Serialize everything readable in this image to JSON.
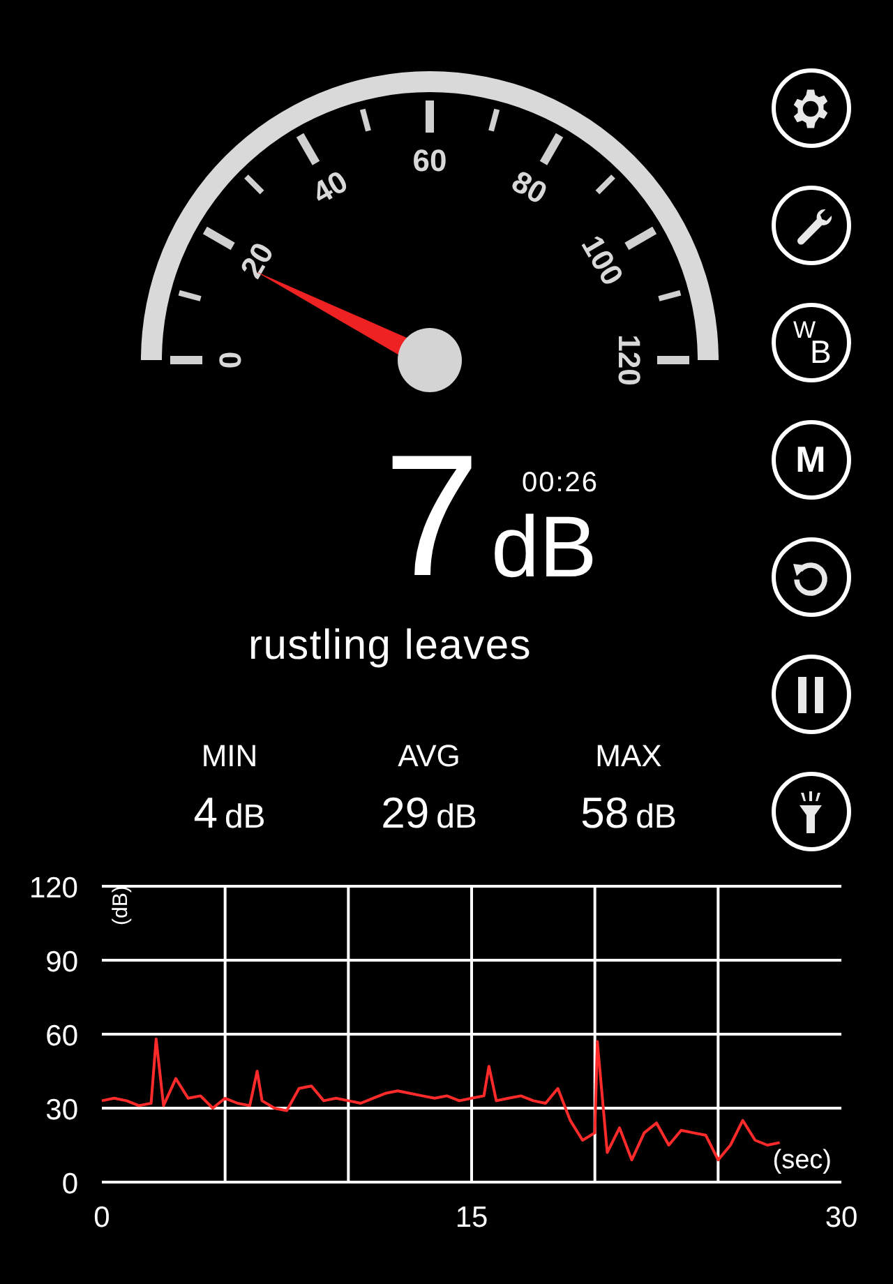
{
  "gauge": {
    "labels": [
      "0",
      "20",
      "40",
      "60",
      "80",
      "100",
      "120"
    ]
  },
  "reading": {
    "value": "7",
    "unit": "dB",
    "timer": "00:26",
    "description": "rustling leaves"
  },
  "stats": [
    {
      "label": "MIN",
      "value": "4",
      "unit": "dB"
    },
    {
      "label": "AVG",
      "value": "29",
      "unit": "dB"
    },
    {
      "label": "MAX",
      "value": "58",
      "unit": "dB"
    }
  ],
  "buttons": [
    {
      "kind": "settings"
    },
    {
      "kind": "wrench"
    },
    {
      "kind": "pair",
      "top": "W",
      "bottom": "B"
    },
    {
      "kind": "letter",
      "label": "M"
    },
    {
      "kind": "reset"
    },
    {
      "kind": "pause"
    },
    {
      "kind": "flashlight"
    }
  ],
  "chart": {
    "chart_data": {
      "type": "line",
      "xlabel": "(sec)",
      "ylabel": "(dB)",
      "xlim": [
        0,
        30
      ],
      "ylim": [
        0,
        120
      ],
      "xticks": [
        0,
        15,
        30
      ],
      "grid": true,
      "yticks": [
        0,
        30,
        60,
        90,
        120
      ],
      "x": [
        0,
        0.5,
        1,
        1.5,
        2,
        2.2,
        2.5,
        3,
        3.5,
        4,
        4.5,
        5,
        5.5,
        6,
        6.3,
        6.5,
        7,
        7.5,
        8,
        8.5,
        9,
        9.5,
        10,
        10.5,
        11,
        11.5,
        12,
        12.5,
        13,
        13.5,
        14,
        14.5,
        15,
        15.5,
        15.7,
        16,
        16.5,
        17,
        17.5,
        18,
        18.5,
        19,
        19.5,
        20,
        20.1,
        20.5,
        21,
        21.5,
        22,
        22.5,
        23,
        23.5,
        24,
        24.5,
        25,
        25.5,
        26,
        26.5,
        27,
        27.5
      ],
      "series": [
        {
          "color": "#ff2a2a",
          "values": [
            33,
            34,
            33,
            31,
            32,
            58,
            31,
            42,
            34,
            35,
            30,
            34,
            32,
            31,
            45,
            33,
            30,
            29,
            38,
            39,
            33,
            34,
            33,
            32,
            34,
            36,
            37,
            36,
            35,
            34,
            35,
            33,
            34,
            35,
            47,
            33,
            34,
            35,
            33,
            32,
            38,
            25,
            17,
            20,
            57,
            12,
            22,
            9,
            20,
            24,
            15,
            21,
            20,
            19,
            9,
            15,
            25,
            17,
            15,
            16
          ]
        }
      ]
    }
  }
}
